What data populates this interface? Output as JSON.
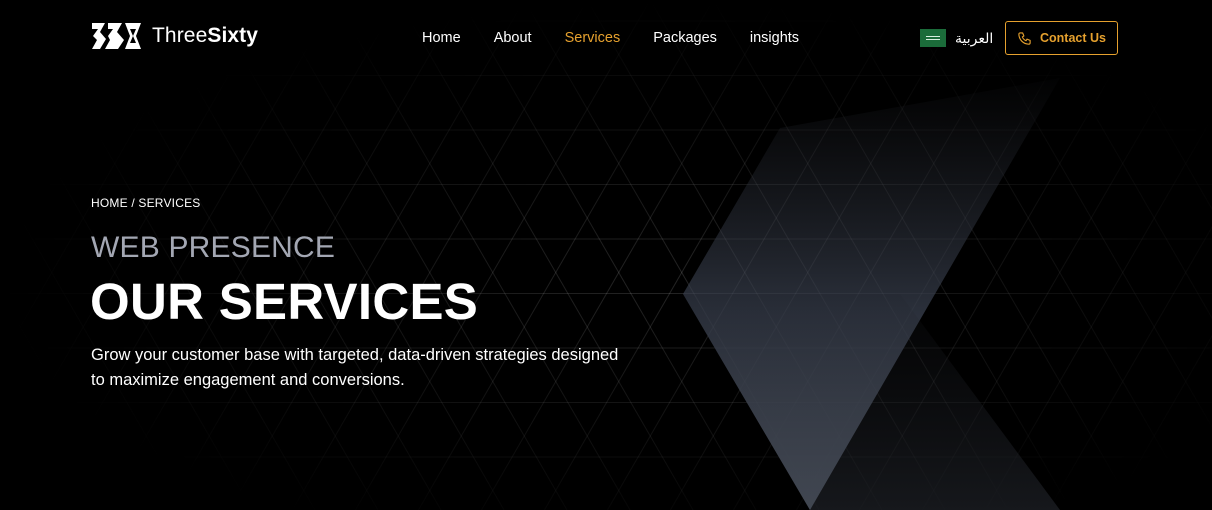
{
  "brand": {
    "mark_icon": "threesixty-logo-icon",
    "name_light": "Three",
    "name_bold": "Sixty"
  },
  "nav": {
    "items": [
      {
        "label": "Home",
        "active": false
      },
      {
        "label": "About",
        "active": false
      },
      {
        "label": "Services",
        "active": true
      },
      {
        "label": "Packages",
        "active": false
      },
      {
        "label": "insights",
        "active": false
      }
    ]
  },
  "language": {
    "flag_icon": "saudi-flag-icon",
    "label": "العربية"
  },
  "contact": {
    "icon": "phone-icon",
    "label": "Contact Us"
  },
  "hero": {
    "breadcrumb": "HOME / SERVICES",
    "eyebrow": "WEB PRESENCE",
    "title": "OUR SERVICES",
    "description": "Grow your customer base with targeted, data-driven strategies designed to maximize engagement and conversions."
  },
  "colors": {
    "accent": "#e6a12e",
    "background": "#000000",
    "muted_text": "#a3a7b3"
  }
}
